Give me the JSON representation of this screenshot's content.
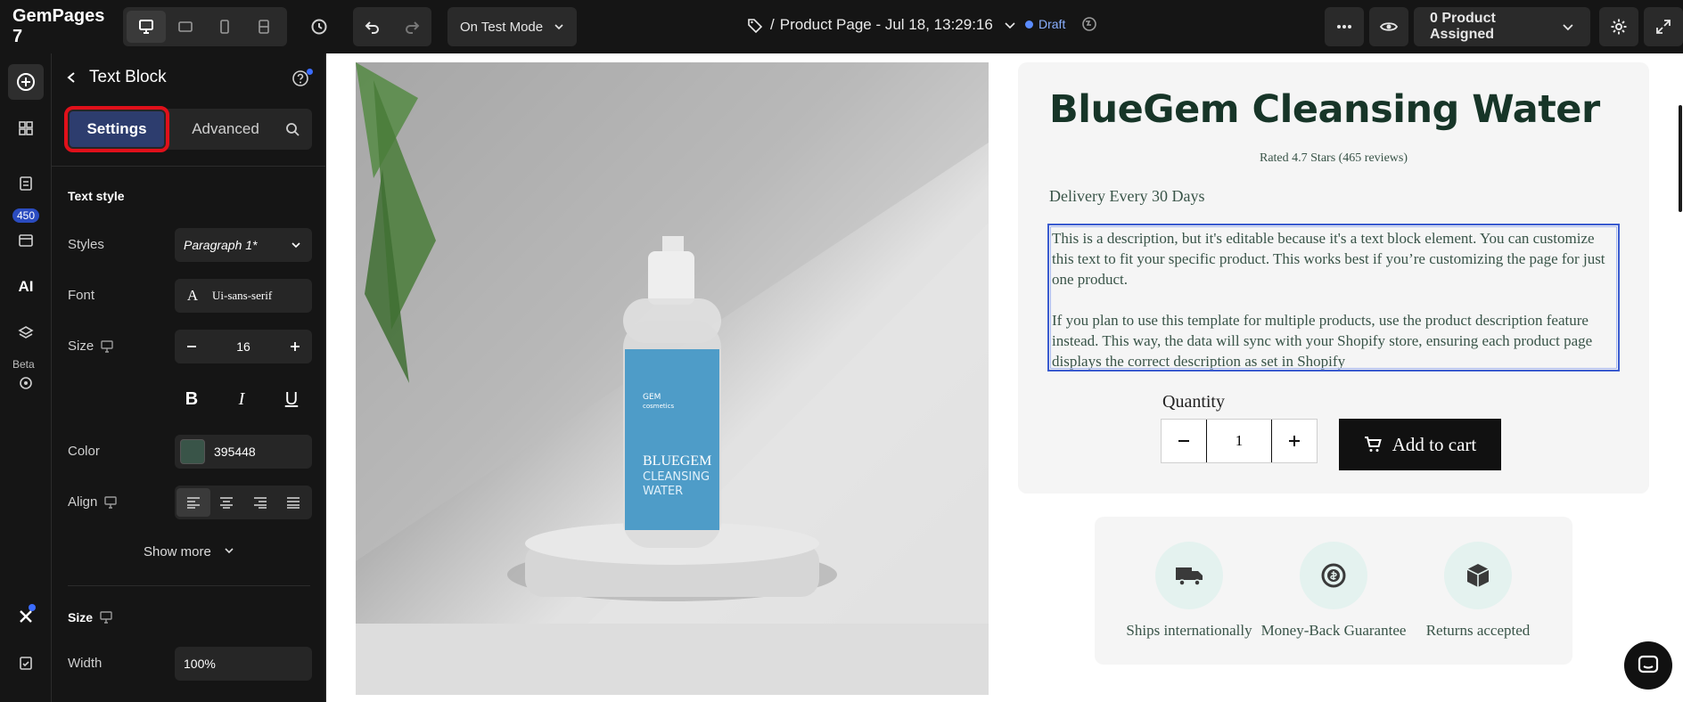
{
  "app": {
    "brand": "GemPages 7"
  },
  "topbar": {
    "mode_label": "On Test Mode",
    "page_prefix": "/",
    "page_title": "Product Page - Jul 18, 13:29:16",
    "status": "Draft",
    "assign_label": "0 Product Assigned"
  },
  "rail": {
    "count_badge": "450",
    "ai_label": "AI",
    "beta_label": "Beta"
  },
  "panel": {
    "title": "Text Block",
    "tabs": {
      "settings": "Settings",
      "advanced": "Advanced"
    },
    "text_style": {
      "section": "Text style",
      "styles_label": "Styles",
      "styles_value": "Paragraph 1*",
      "font_label": "Font",
      "font_glyph": "A",
      "font_value": "Ui-sans-serif",
      "size_label": "Size",
      "size_value": "16",
      "bold": "B",
      "italic": "I",
      "underline": "U",
      "color_label": "Color",
      "color_hex": "#395448",
      "color_value": "395448",
      "align_label": "Align",
      "show_more": "Show more"
    },
    "size_section": {
      "section": "Size",
      "width_label": "Width",
      "width_value": "100%"
    }
  },
  "product": {
    "title": "BlueGem Cleansing Water",
    "rating": "Rated 4.7 Stars (465 reviews)",
    "delivery": "Delivery Every 30 Days",
    "desc_p1": "This is a description, but it's editable because it's a text block element. You can customize this text to fit your specific product. This works best if you’re customizing the page for just one product.",
    "desc_p2": "If you plan to use this template for multiple products, use the product description feature instead. This way, the data will sync with your Shopify store, ensuring each product page displays the correct description as set in Shopify",
    "quantity_label": "Quantity",
    "quantity_value": "1",
    "add_to_cart": "Add to cart",
    "bottle_brand": "GEM",
    "bottle_brand_sub": "cosmetics",
    "bottle_name_1": "BLUEGEM",
    "bottle_name_2": "CLEANSING",
    "bottle_name_3": "WATER"
  },
  "trust": [
    {
      "label": "Ships internationally",
      "icon": "truck-icon"
    },
    {
      "label": "Money-Back Guarantee",
      "icon": "money-back-icon"
    },
    {
      "label": "Returns accepted",
      "icon": "box-icon"
    }
  ],
  "colors": {
    "accent": "#2d3d6e",
    "highlight": "#e0101a",
    "text": "#395448",
    "title": "#173528"
  }
}
